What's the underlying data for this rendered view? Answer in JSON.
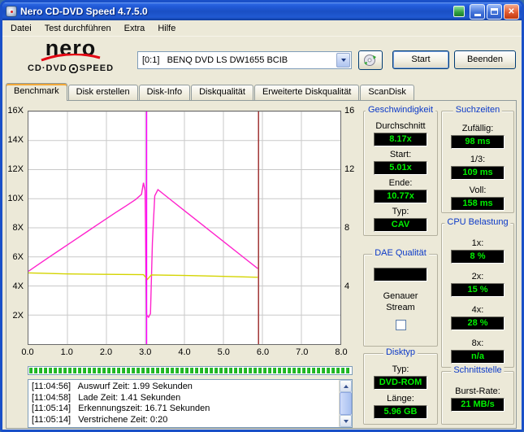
{
  "window": {
    "title": "Nero CD-DVD Speed 4.7.5.0"
  },
  "menu": {
    "items": [
      "Datei",
      "Test durchführen",
      "Extra",
      "Hilfe"
    ]
  },
  "toolbar": {
    "logo_brand": "nero",
    "logo_product_left": "CD·DVD",
    "logo_product_right": "SPEED",
    "drive_value": "[0:1]   BENQ DVD LS DW1655 BCIB",
    "start_label": "Start",
    "quit_label": "Beenden"
  },
  "tabs": [
    {
      "label": "Benchmark",
      "active": true
    },
    {
      "label": "Disk erstellen",
      "active": false
    },
    {
      "label": "Disk-Info",
      "active": false
    },
    {
      "label": "Diskqualität",
      "active": false
    },
    {
      "label": "Erweiterte Diskqualität",
      "active": false
    },
    {
      "label": "ScanDisk",
      "active": false
    }
  ],
  "chart_data": {
    "type": "line",
    "title": "",
    "xlabel": "",
    "ylabel": "",
    "xlim": [
      0,
      8
    ],
    "ylim": [
      0,
      16
    ],
    "grid": true,
    "x_ticks": [
      [
        0,
        "0.0"
      ],
      [
        1,
        "1.0"
      ],
      [
        2,
        "2.0"
      ],
      [
        3,
        "3.0"
      ],
      [
        4,
        "4.0"
      ],
      [
        5,
        "5.0"
      ],
      [
        6,
        "6.0"
      ],
      [
        7,
        "7.0"
      ],
      [
        8,
        "8.0"
      ]
    ],
    "y_ticks_left": [
      [
        16,
        "16X"
      ],
      [
        14,
        "14X"
      ],
      [
        12,
        "12X"
      ],
      [
        10,
        "10X"
      ],
      [
        8,
        "8X"
      ],
      [
        6,
        "6X"
      ],
      [
        4,
        "4X"
      ],
      [
        2,
        "2X"
      ]
    ],
    "y_ticks_right": [
      [
        16,
        "16"
      ],
      [
        12,
        "12"
      ],
      [
        8,
        "8"
      ],
      [
        4,
        "4"
      ]
    ],
    "series": [
      {
        "name": "read_speed",
        "color": "#ff22cc",
        "points": [
          [
            0,
            5.01
          ],
          [
            0.25,
            5.47
          ],
          [
            0.5,
            5.93
          ],
          [
            0.75,
            6.38
          ],
          [
            1,
            6.83
          ],
          [
            1.25,
            7.28
          ],
          [
            1.5,
            7.73
          ],
          [
            1.75,
            8.18
          ],
          [
            2,
            8.63
          ],
          [
            2.25,
            9.07
          ],
          [
            2.5,
            9.5
          ],
          [
            2.75,
            9.95
          ],
          [
            2.9,
            10.3
          ],
          [
            2.95,
            11.1
          ],
          [
            2.99,
            10.55
          ],
          [
            3.03,
            2.0
          ],
          [
            3.08,
            1.85
          ],
          [
            3.13,
            2.1
          ],
          [
            3.18,
            7.0
          ],
          [
            3.24,
            10.2
          ],
          [
            3.32,
            10.62
          ],
          [
            3.6,
            10.03
          ],
          [
            4,
            9.18
          ],
          [
            4.5,
            8.12
          ],
          [
            5,
            7.06
          ],
          [
            5.5,
            6.0
          ],
          [
            5.88,
            5.2
          ]
        ]
      },
      {
        "name": "rotation_speed",
        "color": "#d4d400",
        "points": [
          [
            0,
            4.9
          ],
          [
            1,
            4.83
          ],
          [
            2,
            4.8
          ],
          [
            2.95,
            4.78
          ],
          [
            3.05,
            4.45
          ],
          [
            3.15,
            4.76
          ],
          [
            4,
            4.72
          ],
          [
            5,
            4.66
          ],
          [
            5.88,
            4.6
          ]
        ]
      }
    ],
    "markers": [
      {
        "name": "position-cursor",
        "x": 3.03,
        "color": "#ff00ff"
      },
      {
        "name": "disc-end-line",
        "x": 5.9,
        "color": "#a03434"
      }
    ]
  },
  "progress": {
    "percent": 100
  },
  "panels": {
    "speed": {
      "title": "Geschwindigkeit",
      "rows": [
        {
          "label": "Durchschnitt",
          "value": "8.17x"
        },
        {
          "label": "Start:",
          "value": "5.01x"
        },
        {
          "label": "Ende:",
          "value": "10.77x"
        },
        {
          "label": "Typ:",
          "value": "CAV"
        }
      ]
    },
    "seek": {
      "title": "Suchzeiten",
      "rows": [
        {
          "label": "Zufällig:",
          "value": "98 ms"
        },
        {
          "label": "1/3:",
          "value": "109 ms"
        },
        {
          "label": "Voll:",
          "value": "158 ms"
        }
      ]
    },
    "cpu": {
      "title": "CPU Belastung",
      "rows": [
        {
          "label": "1x:",
          "value": "8 %"
        },
        {
          "label": "2x:",
          "value": "15 %"
        },
        {
          "label": "4x:",
          "value": "28 %"
        },
        {
          "label": "8x:",
          "value": "n/a"
        }
      ]
    },
    "dae": {
      "title": "DAE Qualität",
      "value": "",
      "checkbox_label_1": "Genauer",
      "checkbox_label_2": "Stream",
      "checkbox_checked": false
    },
    "disc": {
      "title": "Disktyp",
      "rows": [
        {
          "label": "Typ:",
          "value": "DVD-ROM"
        },
        {
          "label": "Länge:",
          "value": "5.96 GB"
        }
      ]
    },
    "interface": {
      "title": "Schnittstelle",
      "rows": [
        {
          "label": "Burst-Rate:",
          "value": "21 MB/s"
        }
      ]
    }
  },
  "log": {
    "lines": [
      "[11:04:56]   Auswurf Zeit: 1.99 Sekunden",
      "[11:04:58]   Lade Zeit: 1.41 Sekunden",
      "[11:05:14]   Erkennungszeit: 16.71 Sekunden",
      "[11:05:14]   Verstrichene Zeit: 0:20"
    ]
  },
  "colors": {
    "value_text": "#00f000",
    "value_bg": "#000000",
    "section_title": "#0b39c8",
    "titlebar": "#1a4fc4"
  }
}
